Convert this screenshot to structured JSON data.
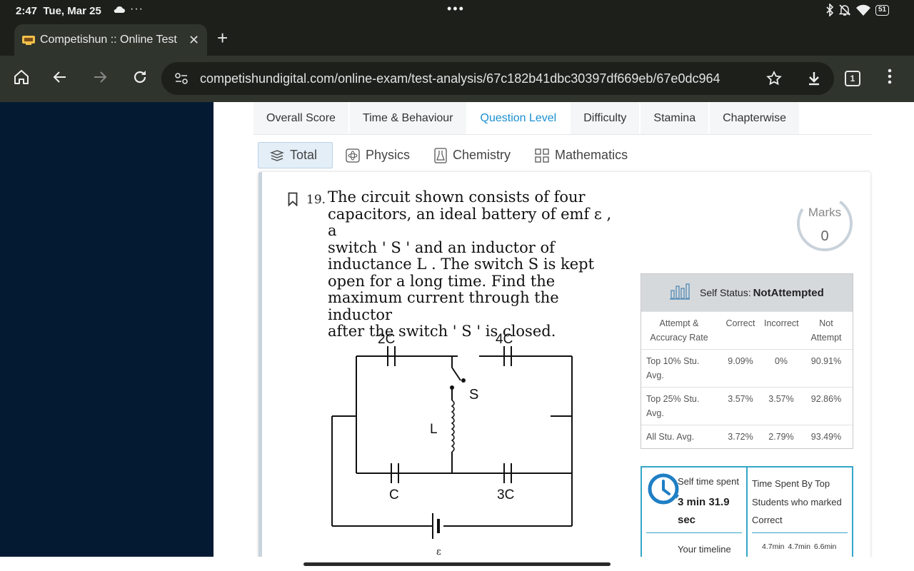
{
  "status_bar": {
    "time": "2:47",
    "date": "Tue, Mar 25",
    "more": "···",
    "center_dots": "•••",
    "battery": "51"
  },
  "browser": {
    "tab_title": "Competishun :: Online Test S",
    "url": "competishundigital.com/online-exam/test-analysis/67c182b41dbc30397df669eb/67e0dc964",
    "tab_count": "1"
  },
  "analysis_tabs": [
    "Overall Score",
    "Time & Behaviour",
    "Question Level",
    "Difficulty",
    "Stamina",
    "Chapterwise"
  ],
  "subject_tabs": [
    "Total",
    "Physics",
    "Chemistry",
    "Mathematics"
  ],
  "question": {
    "number": "19.",
    "lines": [
      "The circuit shown consists of four",
      "capacitors, an ideal battery of emf ε , a",
      "switch ' S ' and an inductor of",
      "inductance L . The switch  S  is kept",
      "open for a long time. Find the",
      "maximum current through the inductor",
      "after the switch ' S ' is closed."
    ]
  },
  "circuit": {
    "labels": {
      "cap_top_left": "2C",
      "cap_top_right": "4C",
      "switch": "S",
      "inductor": "L",
      "cap_bottom_left": "C",
      "cap_bottom_right": "3C",
      "emf": "ε"
    }
  },
  "marks": {
    "label": "Marks",
    "value": "0"
  },
  "self_status": {
    "label": "Self Status:",
    "value": "NotAttempted"
  },
  "accuracy_table": {
    "headers": [
      "Attempt & Accuracy Rate",
      "Correct",
      "Incorrect",
      "Not Attempt"
    ],
    "rows": [
      [
        "Top 10% Stu. Avg.",
        "9.09%",
        "0%",
        "90.91%"
      ],
      [
        "Top 25% Stu. Avg.",
        "3.57%",
        "3.57%",
        "92.86%"
      ],
      [
        "All Stu. Avg.",
        "3.72%",
        "2.79%",
        "93.49%"
      ]
    ]
  },
  "time_spent": {
    "self_label": "Self time spent",
    "self_value": "3 min 31.9 sec",
    "top_label": "Time Spent By Top Students who marked Correct",
    "timeline_label": "Your timeline",
    "timeline_values": "4.7min 4.7min 6.6min"
  },
  "colors": {
    "accent": "#1a8fd0",
    "teal_border": "#35a6c7",
    "sidebar": "#041a33"
  }
}
